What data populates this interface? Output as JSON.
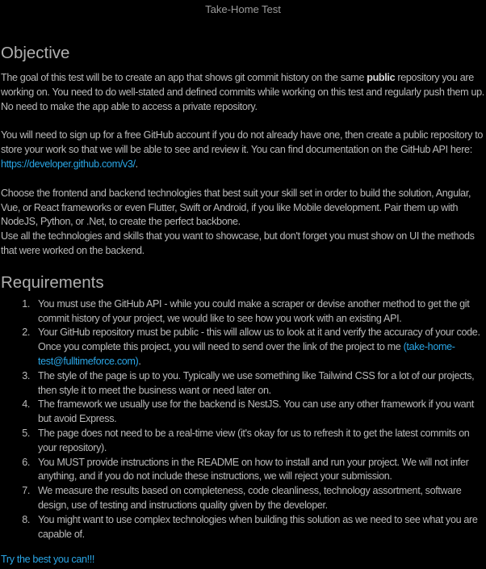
{
  "window": {
    "title": "Take-Home Test"
  },
  "objective": {
    "heading": "Objective",
    "p1_start": "The goal of this test will be to create an app that shows git commit history on the same ",
    "p1_bold": "public",
    "p1_end": " repository you are working on. You need to do well-stated and defined commits while working on this test and regularly push them up. No need to make the app able to access a private repository.",
    "p2_start": "You will need to sign up for a free GitHub account if you do not already have one, then create a public repository to store your work so that we will be able to see and review it. You can find documentation on the GitHub API here: ",
    "p2_link": "https://developer.github.com/v3/",
    "p2_end": ".",
    "p3": "Choose the frontend and backend technologies that best suit your skill set in order to build the solution,  Angular, Vue, or React frameworks or even Flutter, Swift or Android, if you like Mobile development. Pair them up with NodeJS, Python, or .Net, to create the perfect backbone.",
    "p4": "Use all the technologies and skills that you want to showcase, but don't forget you must show on UI the methods that were worked on the backend."
  },
  "requirements": {
    "heading": "Requirements",
    "items": [
      {
        "num": "1.",
        "text": "You must use the GitHub API - while you could make a scraper or devise another method to get the git commit history of your project, we would like to see how you work with an existing API."
      },
      {
        "num": "2.",
        "text_start": "Your GitHub repository must be public - this will allow us to look at it and verify the accuracy of your code. Once you complete this project, you will need to send over the link of the project to me ",
        "link": "(take-home-test@fulltimeforce.com)",
        "text_end": "."
      },
      {
        "num": "3.",
        "text": "The style of the page is up to you. Typically we use something like Tailwind CSS for a lot of our projects, then style it to meet the business want or need later on."
      },
      {
        "num": "4.",
        "text": "The framework we usually use for the backend is NestJS. You can use any other framework if you want but avoid Express."
      },
      {
        "num": "5.",
        "text": "The page does not need to be a real-time view (it's okay for us to refresh it to get the latest commits on your repository)."
      },
      {
        "num": "6.",
        "text": "You MUST provide instructions in the README on how to install and run your project. We will not infer anything, and if you do not include these instructions, we will reject your submission."
      },
      {
        "num": "7.",
        "text": "We measure the results based on completeness, code cleanliness, technology assortment, software design, use of testing and instructions quality given by the developer."
      },
      {
        "num": "8.",
        "text": "You might want to use complex technologies when building this solution as we need to see what you are capable of."
      }
    ]
  },
  "footer": {
    "closing": "Try the best you can!!!"
  },
  "colors": {
    "background": "#000000",
    "text": "#b9b9b9",
    "link": "#2aa6e6"
  }
}
